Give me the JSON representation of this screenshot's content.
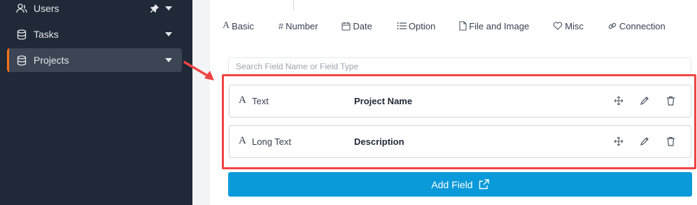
{
  "sidebar": {
    "items": [
      {
        "label": "Users",
        "icon": "users-icon"
      },
      {
        "label": "Tasks",
        "icon": "database-icon"
      },
      {
        "label": "Projects",
        "icon": "database-icon"
      }
    ]
  },
  "tabs": [
    {
      "label": "Basic",
      "icon": "text-icon"
    },
    {
      "label": "Number",
      "icon": "hash-icon"
    },
    {
      "label": "Date",
      "icon": "calendar-icon"
    },
    {
      "label": "Option",
      "icon": "list-icon"
    },
    {
      "label": "File and Image",
      "icon": "file-icon"
    },
    {
      "label": "Misc",
      "icon": "heart-icon"
    },
    {
      "label": "Connection",
      "icon": "link-icon"
    }
  ],
  "search": {
    "placeholder": "Search Field Name or Field Type"
  },
  "fields": [
    {
      "type": "Text",
      "name": "Project Name"
    },
    {
      "type": "Long Text",
      "name": "Description"
    }
  ],
  "add_field": {
    "label": "Add Field"
  },
  "colors": {
    "sidebar_bg": "#1f2937",
    "accent": "#f97316",
    "highlight": "#ef4444",
    "button": "#0b9ad9"
  }
}
